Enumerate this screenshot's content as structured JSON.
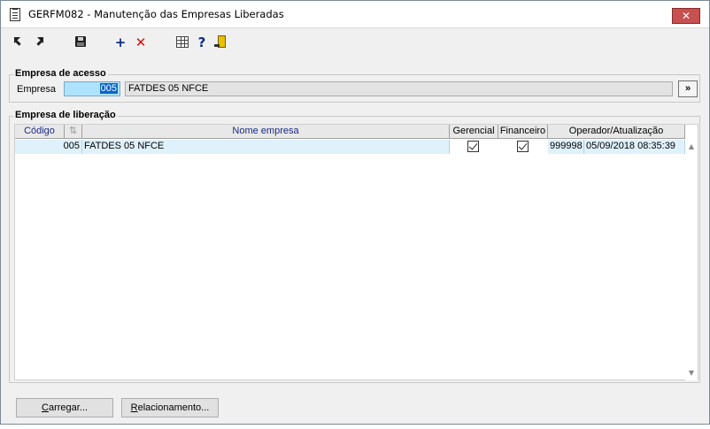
{
  "window": {
    "title": "GERFM082 - Manutenção das Empresas Liberadas",
    "close_label": "✕"
  },
  "toolbar": {
    "icons": [
      "first-record-icon",
      "previous-record-icon",
      "save-icon",
      "add-icon",
      "delete-icon",
      "calendar-icon",
      "help-icon",
      "exit-icon"
    ],
    "add_glyph": "+",
    "delete_glyph": "✕",
    "help_glyph": "?"
  },
  "empresa_acesso": {
    "title": "Empresa de acesso",
    "label": "Empresa",
    "code": "005",
    "name": "FATDES 05 NFCE",
    "lookup_label": "»"
  },
  "empresa_liberacao": {
    "title": "Empresa de liberação",
    "columns": {
      "codigo": "Código",
      "sort": "⇅",
      "nome": "Nome empresa",
      "gerencial": "Gerencial",
      "financeiro": "Financeiro",
      "operador": "Operador/Atualização"
    },
    "rows": [
      {
        "codigo": "005",
        "nome": "FATDES 05 NFCE",
        "gerencial": true,
        "financeiro": true,
        "operador": "999998",
        "atualizacao": "05/09/2018 08:35:39"
      }
    ]
  },
  "buttons": {
    "carregar_mnemonic": "C",
    "carregar_rest": "arregar...",
    "relacionamento_mnemonic": "R",
    "relacionamento_rest": "elacionamento..."
  },
  "colors": {
    "accent": "#0a66c8",
    "selected_row": "#dff1fb",
    "header_text": "#1a2a88",
    "close": "#c75050"
  }
}
